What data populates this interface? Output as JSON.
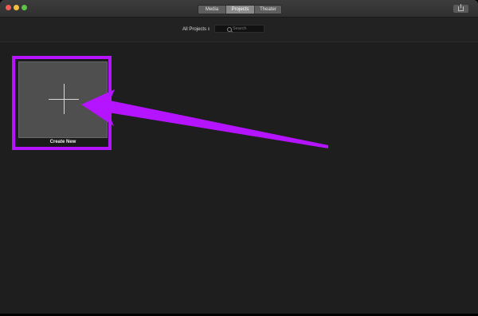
{
  "titlebar": {
    "tabs": [
      {
        "label": "Media",
        "selected": false
      },
      {
        "label": "Projects",
        "selected": true
      },
      {
        "label": "Theater",
        "selected": false
      }
    ]
  },
  "filter": {
    "label": "All Projects"
  },
  "search": {
    "placeholder": "Search"
  },
  "project_card": {
    "label": "Create New"
  },
  "icons": {
    "traffic": [
      "close-icon",
      "minimize-icon",
      "zoom-icon"
    ],
    "share": "share-icon",
    "search": "search-icon",
    "add": "plus-icon"
  },
  "colors": {
    "highlight": "#b414ff",
    "traffic_close": "#ee5e56",
    "traffic_minimize": "#f4bd3c",
    "traffic_zoom": "#5cc344"
  }
}
